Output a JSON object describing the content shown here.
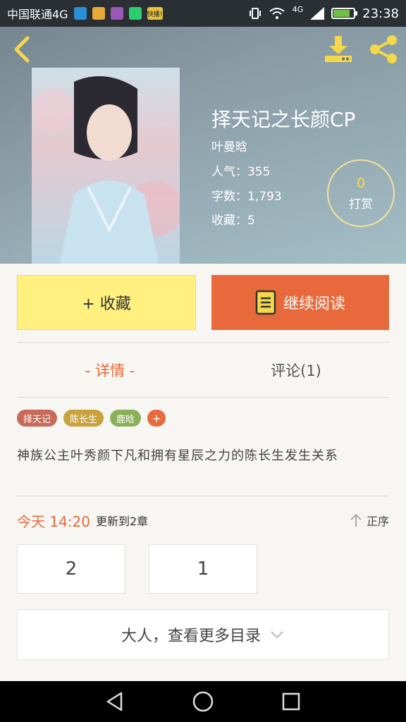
{
  "status_bar": {
    "carrier": "中国联通4G",
    "time": "23:38",
    "network": "4G",
    "app_icons": [
      {
        "name": "bluetooth-app-icon",
        "color": "#2a8fd6"
      },
      {
        "name": "lock-app-icon",
        "color": "#e8a93b"
      },
      {
        "name": "gallery-app-icon",
        "color": "#9b59b6"
      },
      {
        "name": "grid-app-icon",
        "color": "#2ecc71"
      },
      {
        "name": "kuaibo-app-icon",
        "color": "#e8c23b"
      }
    ],
    "kuaibo_label": "快播!"
  },
  "book": {
    "title": "择天记之长颜CP",
    "author": "叶曼晗",
    "popularity": "人气：355",
    "word_count": "字数：1,793",
    "favorites": "收藏：5",
    "tip_count": "0",
    "tip_label": "打赏"
  },
  "actions": {
    "collect": "+ 收藏",
    "read": "继续阅读"
  },
  "tabs": {
    "detail": "- 详情 -",
    "comments": "评论(1)"
  },
  "tags": [
    {
      "label": "择天记",
      "color": "#c86a5a"
    },
    {
      "label": "陈长生",
      "color": "#c9a23b"
    },
    {
      "label": "鹿晗",
      "color": "#8bb05a"
    }
  ],
  "tag_add": "+",
  "synopsis": "神族公主叶秀颜下凡和拥有星辰之力的陈长生发生关系",
  "update": {
    "today": "今天 14:20",
    "text": "更新到2章",
    "sort": "正序"
  },
  "chapters": [
    "2",
    "1"
  ],
  "more": "大人，查看更多目录",
  "colors": {
    "accent": "#e8693b",
    "collect_bg": "#fff080"
  }
}
